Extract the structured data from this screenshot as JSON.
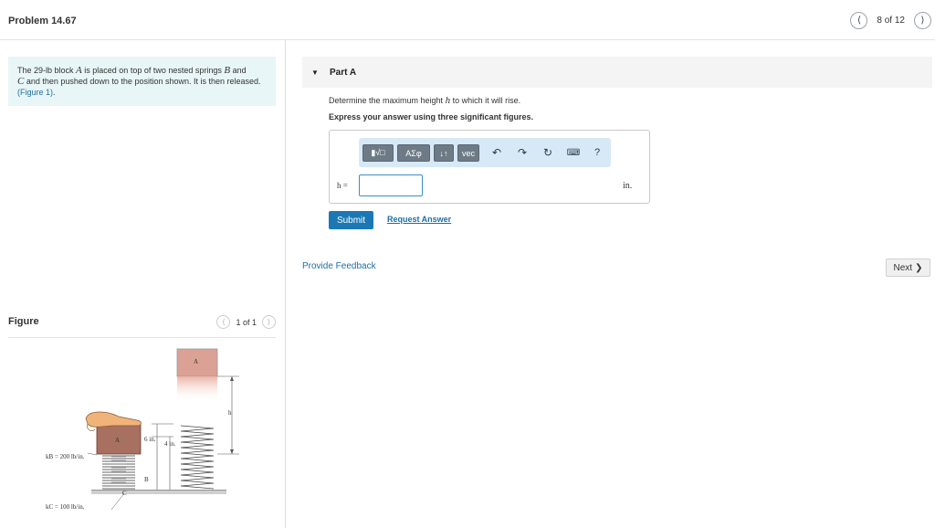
{
  "header": {
    "title": "Problem 14.67",
    "pager_text": "8 of 12",
    "prev_icon": "chevron-left-icon",
    "next_icon": "chevron-right-icon"
  },
  "problem": {
    "text_1": "The 29-lb block ",
    "var_a": "A",
    "text_2": " is placed on top of two nested springs ",
    "var_b": "B",
    "text_3": " and ",
    "var_c": "C",
    "text_4": " and then pushed down to the position shown. It is then released. ",
    "figure_link": "(Figure 1)",
    "text_5": "."
  },
  "figure": {
    "title": "Figure",
    "pager_text": "1 of 1",
    "labels": {
      "block_top": "A",
      "block_bottom": "A",
      "h": "h",
      "six_in": "6 in.",
      "four_in": "4 in.",
      "kb": "kB = 200 lb/in.",
      "kc": "kC = 100 lb/in.",
      "spring_b": "B",
      "spring_c": "C"
    }
  },
  "part_a": {
    "title": "Part A",
    "question_pre": "Determine the maximum height ",
    "question_var": "h",
    "question_post": " to which it will rise.",
    "instruction": "Express your answer using three significant figures.",
    "toolbar": {
      "templates_label": "▮√□",
      "greek_label": "ΑΣφ",
      "arrows_label": "↓↑",
      "vec_label": "vec",
      "undo_icon": "undo-icon",
      "redo_icon": "redo-icon",
      "reset_icon": "reset-icon",
      "keyboard_icon": "keyboard-icon",
      "help_label": "?"
    },
    "answer_label": "h =",
    "answer_value": "",
    "unit": "in.",
    "submit_label": "Submit",
    "request_label": "Request Answer"
  },
  "footer": {
    "feedback_label": "Provide Feedback",
    "next_label": "Next"
  },
  "colors": {
    "problem_bg": "#e8f6f7",
    "link": "#1d6fa5",
    "submit_bg": "#1b78b4",
    "toolbar_bg": "#d7e9f7"
  }
}
